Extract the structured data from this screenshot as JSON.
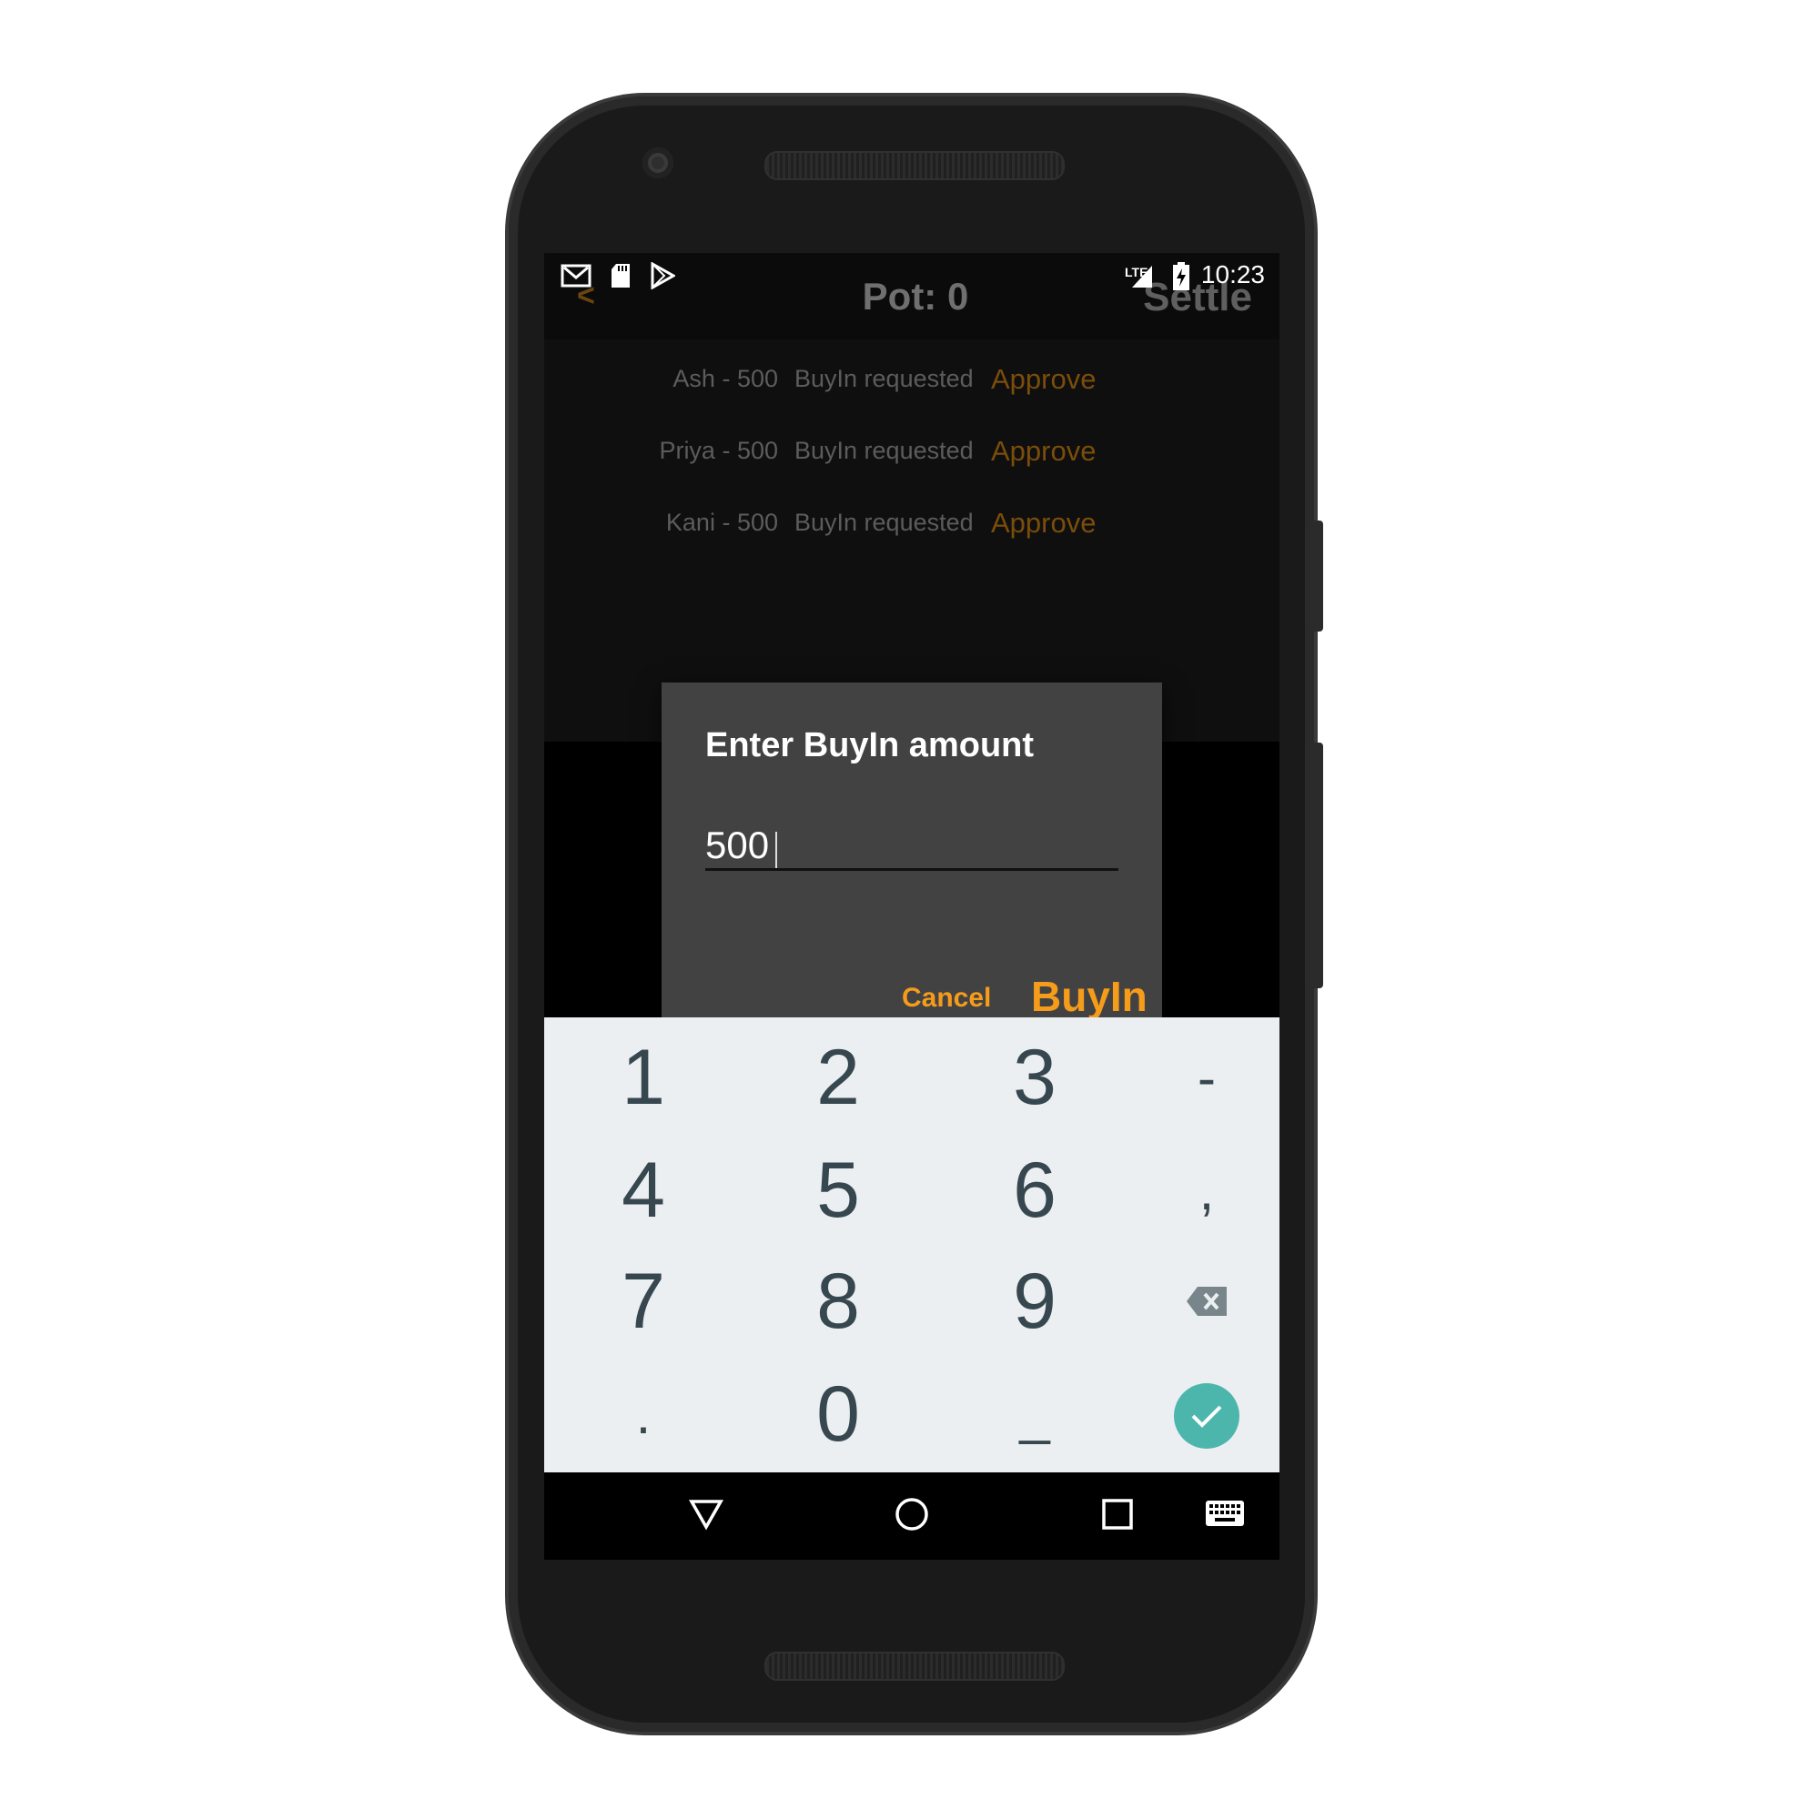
{
  "status_bar": {
    "time": "10:23",
    "network": "LTE",
    "left_icons": [
      "gmail-icon",
      "sd-card-icon",
      "play-store-icon"
    ]
  },
  "app_bar": {
    "title": "Pot: 0",
    "settle_label": "Settle",
    "back_glyph": "<"
  },
  "requests": [
    {
      "name": "Ash - 500",
      "status": "BuyIn requested",
      "action": "Approve"
    },
    {
      "name": "Priya - 500",
      "status": "BuyIn requested",
      "action": "Approve"
    },
    {
      "name": "Kani - 500",
      "status": "BuyIn requested",
      "action": "Approve"
    }
  ],
  "dialog": {
    "title": "Enter BuyIn amount",
    "amount_value": "500",
    "cancel_label": "Cancel",
    "confirm_label": "BuyIn"
  },
  "keyboard": {
    "keys": [
      "1",
      "2",
      "3",
      "-",
      "4",
      "5",
      "6",
      ",",
      "7",
      "8",
      "9",
      ".",
      "0",
      "_"
    ]
  },
  "colors": {
    "accent_orange": "#f59c1a",
    "dim_orange": "#7a4d0b",
    "keyboard_bg": "#eceff1",
    "enter_teal": "#4db6ac",
    "dialog_bg": "#424242"
  }
}
